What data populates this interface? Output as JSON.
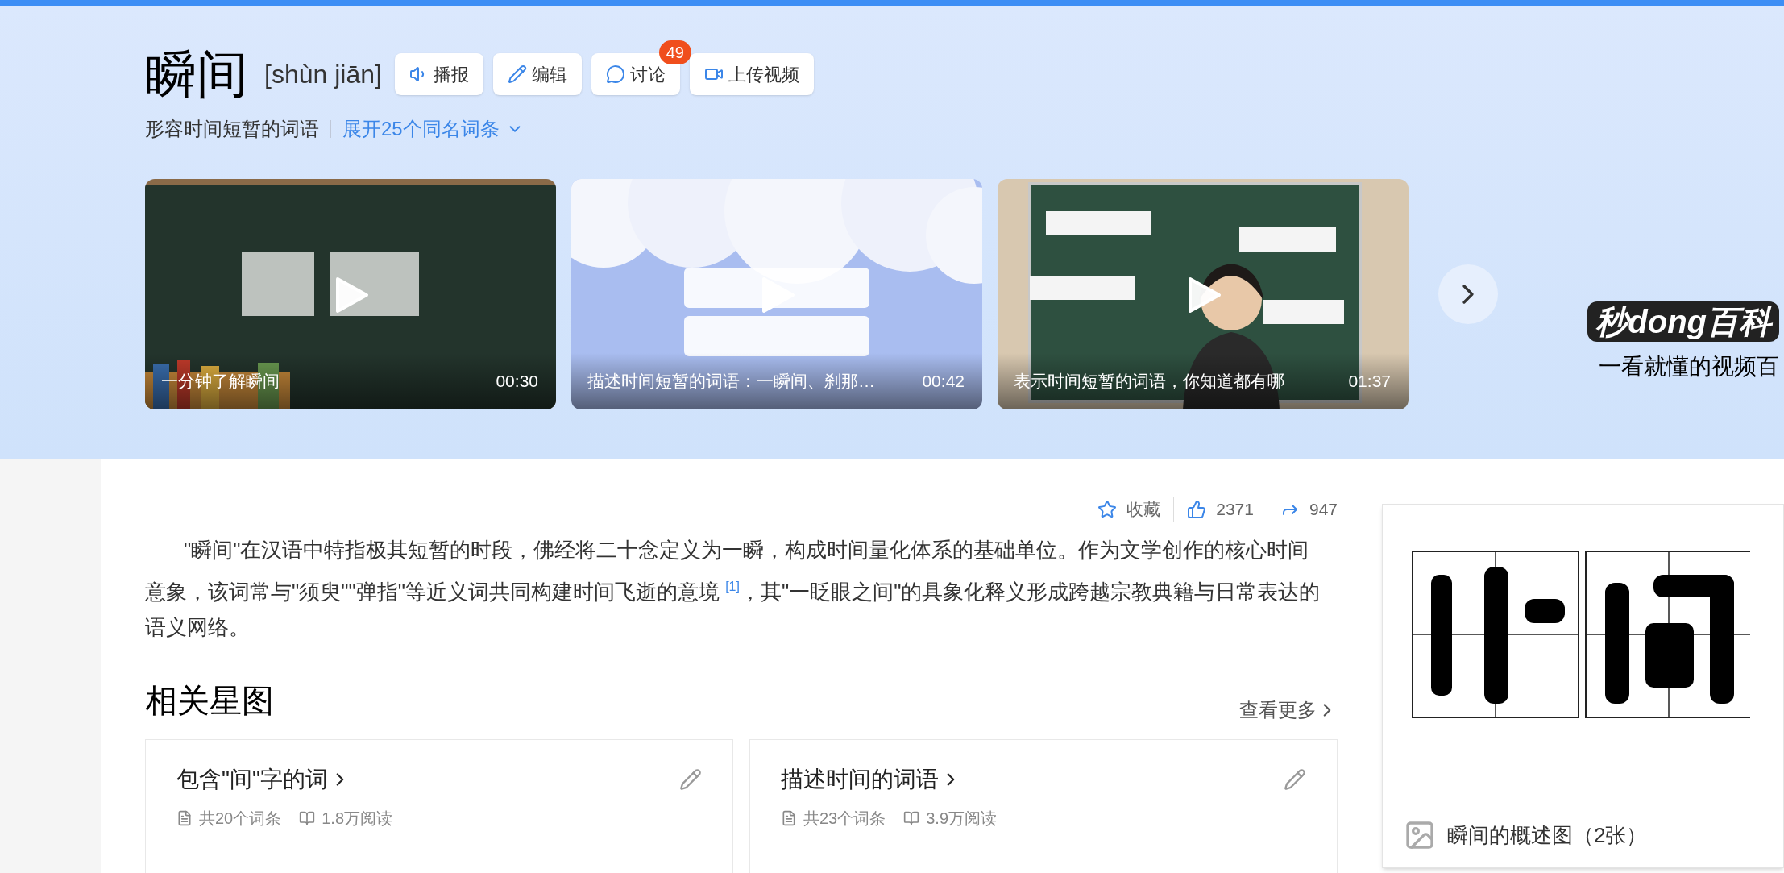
{
  "header": {
    "title": "瞬间",
    "pinyin": "[shùn jiān]",
    "actions": [
      {
        "label": "播报"
      },
      {
        "label": "编辑"
      },
      {
        "label": "讨论",
        "badge": "49"
      },
      {
        "label": "上传视频"
      }
    ],
    "subtitle": "形容时间短暂的词语",
    "expand_link": "展开25个同名词条"
  },
  "videos": [
    {
      "caption": "一分钟了解瞬间",
      "duration": "00:30",
      "kind": "board"
    },
    {
      "caption": "描述时间短暂的词语：一瞬间、刹那…",
      "duration": "00:42",
      "kind": "clouds"
    },
    {
      "caption": "表示时间短暂的词语，你知道都有哪",
      "duration": "01:37",
      "kind": "teacher"
    }
  ],
  "banner_logo": {
    "name": "秒dong百科",
    "slogan": "一看就懂的视频百"
  },
  "stats": [
    {
      "label": "收藏"
    },
    {
      "label": "2371"
    },
    {
      "label": "947"
    }
  ],
  "summary": {
    "before": "\"瞬间\"在汉语中特指极其短暂的时段，佛经将二十念定义为一瞬，构成时间量化体系的基础单位。作为文学创作的核心时间意象，该词常与\"须臾\"\"弹指\"等近义词共同构建时间飞逝的意境 ",
    "ref": "[1]",
    "after": "，其\"一眨眼之间\"的具象化释义形成跨越宗教典籍与日常表达的语义网络。"
  },
  "related": {
    "title": "相关星图",
    "more": "查看更多",
    "cards": [
      {
        "title": "包含\"间\"字的词",
        "entries": "共20个词条",
        "reads": "1.8万阅读"
      },
      {
        "title": "描述时间的词语",
        "entries": "共23个词条",
        "reads": "3.9万阅读"
      }
    ]
  },
  "overview_image": {
    "caption": "瞬间的概述图（2张）"
  }
}
